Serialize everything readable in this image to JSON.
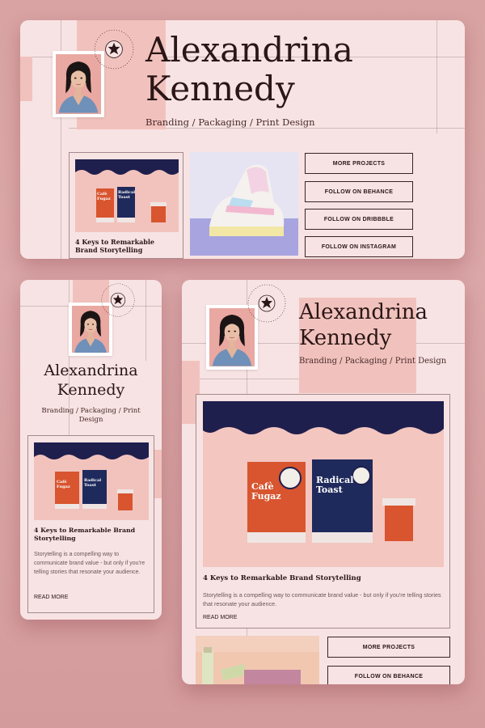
{
  "profile": {
    "name_line1": "Alexandrina",
    "name_line2": "Kennedy",
    "tagline": "Branding / Packaging / Print Design",
    "tagline_line1": "Branding / Packaging / Print",
    "tagline_line2": "Design",
    "badge_text": "Alexandrina Certified"
  },
  "post": {
    "title": "4 Keys to Remarkable Brand Storytelling",
    "title_line1": "4 Keys to Remarkable Brand",
    "title_line2": "Storytelling",
    "description": "Storytelling is a compelling way to communicate brand value - but only if you're telling stories that resonate your audience.",
    "read_more": "READ MORE",
    "pouch1_line1": "Cafè",
    "pouch1_line2": "Fugaz",
    "pouch2_line1": "Radical",
    "pouch2_line2": "Toast"
  },
  "links": {
    "more_projects": "MORE PROJECTS",
    "behance": "FOLLOW ON BEHANCE",
    "dribbble": "FOLLOW ON DRIBBBLE",
    "instagram": "FOLLOW ON INSTAGRAM"
  },
  "colors": {
    "background": "#d9a3a3",
    "card": "#f7e3e3",
    "accent_pink": "#f1c2bd",
    "navy": "#1f1f4d",
    "orange": "#d8552f",
    "text": "#2a1616"
  }
}
